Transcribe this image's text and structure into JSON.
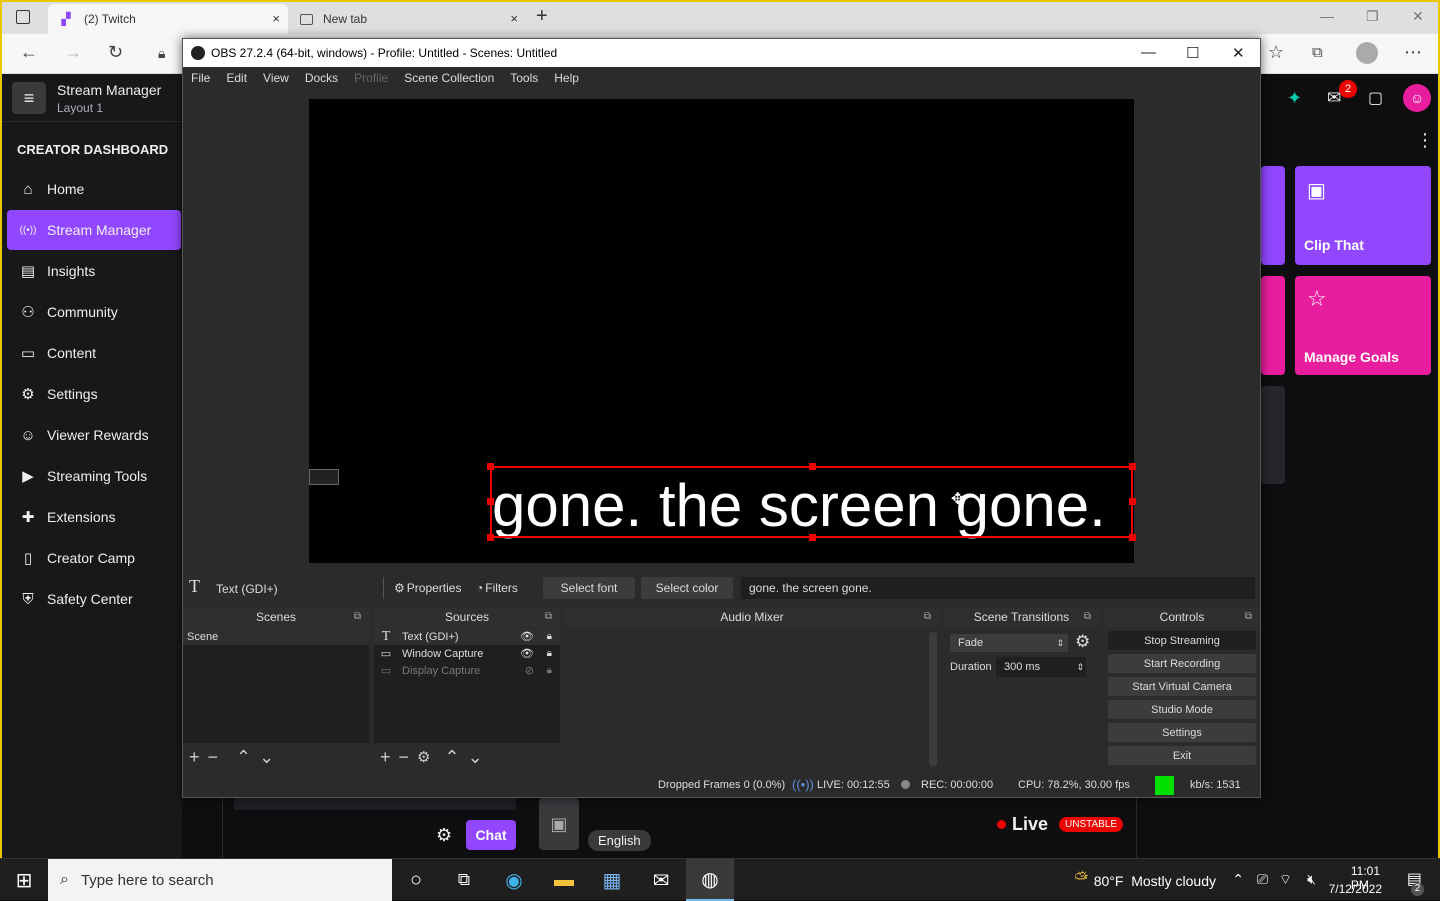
{
  "browser": {
    "tabs": [
      {
        "title": "(2) Twitch"
      },
      {
        "title": "New tab"
      }
    ],
    "close_glyph": "×",
    "newtab_glyph": "+"
  },
  "twitch": {
    "stream_manager": "Stream Manager",
    "layout": "Layout 1",
    "creator_dashboard": "CREATOR DASHBOARD",
    "nav": [
      {
        "label": "Home",
        "icon": "home-icon",
        "glyph": "⌂"
      },
      {
        "label": "Stream Manager",
        "icon": "broadcast-icon",
        "glyph": "((•))"
      },
      {
        "label": "Insights",
        "icon": "chart-icon",
        "glyph": "▤"
      },
      {
        "label": "Community",
        "icon": "community-icon",
        "glyph": "⚇"
      },
      {
        "label": "Content",
        "icon": "content-icon",
        "glyph": "▭"
      },
      {
        "label": "Settings",
        "icon": "gear-icon",
        "glyph": "⚙"
      },
      {
        "label": "Viewer Rewards",
        "icon": "rewards-icon",
        "glyph": "☺"
      },
      {
        "label": "Streaming Tools",
        "icon": "camera-icon",
        "glyph": "▶"
      },
      {
        "label": "Extensions",
        "icon": "puzzle-icon",
        "glyph": "✚"
      },
      {
        "label": "Creator Camp",
        "icon": "book-icon",
        "glyph": "▯"
      },
      {
        "label": "Safety Center",
        "icon": "shield-icon",
        "glyph": "⛨"
      }
    ],
    "notification_count": "2",
    "tiles": {
      "clip": "Clip That",
      "goals": "Manage Goals"
    },
    "chat_label": "Chat",
    "live_label": "Live",
    "unstable_label": "UNSTABLE",
    "language": "English",
    "accent": "#9147ff",
    "tile_colors": [
      "#9147ff",
      "#e91e9f"
    ]
  },
  "obs": {
    "title": "OBS 27.2.4 (64-bit, windows) - Profile: Untitled - Scenes: Untitled",
    "menu": [
      "File",
      "Edit",
      "View",
      "Docks",
      "Profile",
      "Scene Collection",
      "Tools",
      "Help"
    ],
    "preview_text": "gone. the screen gone.",
    "source_toolbar": {
      "source_name": "Text (GDI+)",
      "properties": "Properties",
      "filters": "Filters",
      "select_font": "Select font",
      "select_color": "Select color",
      "text_value": "gone. the screen gone."
    },
    "docks": {
      "scenes": {
        "title": "Scenes",
        "items": [
          "Scene"
        ]
      },
      "sources": {
        "title": "Sources",
        "items": [
          {
            "name": "Text (GDI+)",
            "icon": "text-icon",
            "glyph": "T",
            "visible": true
          },
          {
            "name": "Window Capture",
            "icon": "window-icon",
            "glyph": "▭",
            "visible": true
          },
          {
            "name": "Display Capture",
            "icon": "monitor-icon",
            "glyph": "▭",
            "visible": false
          }
        ]
      },
      "mixer": {
        "title": "Audio Mixer"
      },
      "transitions": {
        "title": "Scene Transitions",
        "type": "Fade",
        "duration_label": "Duration",
        "duration": "300 ms"
      },
      "controls": {
        "title": "Controls",
        "buttons": [
          "Stop Streaming",
          "Start Recording",
          "Start Virtual Camera",
          "Studio Mode",
          "Settings",
          "Exit"
        ]
      }
    },
    "status": {
      "dropped": "Dropped Frames 0 (0.0%)",
      "live": "LIVE: 00:12:55",
      "rec": "REC: 00:00:00",
      "cpu": "CPU: 78.2%, 30.00 fps",
      "kbps": "kb/s: 1531",
      "health_color": "#00e000"
    }
  },
  "taskbar": {
    "search_placeholder": "Type here to search",
    "weather": "80°F  Mostly cloudy",
    "time": "11:01 PM",
    "date": "7/12/2022",
    "notif_count": "2"
  }
}
